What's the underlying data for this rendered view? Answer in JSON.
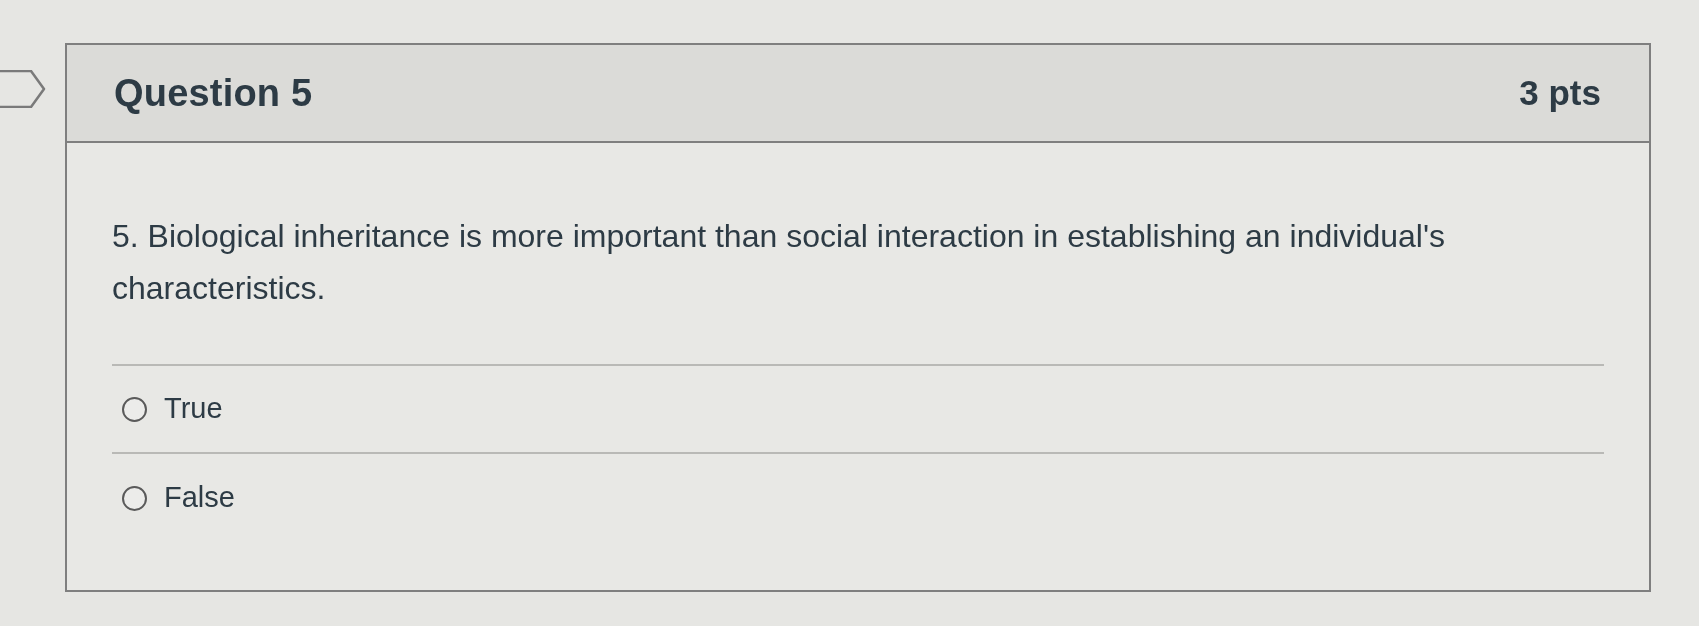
{
  "question": {
    "title": "Question 5",
    "points": "3 pts",
    "flagged": false
  },
  "prompt": "5. Biological inheritance is more important than social interaction in establishing an individual's characteristics.",
  "answers": [
    {
      "label": "True",
      "selected": false
    },
    {
      "label": "False",
      "selected": false
    }
  ]
}
